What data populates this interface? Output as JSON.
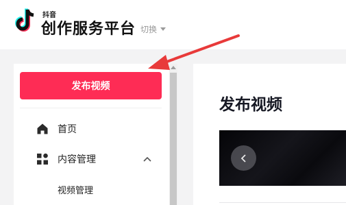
{
  "header": {
    "brand_small": "抖音",
    "brand_main": "创作服务平台",
    "switch_label": "切换"
  },
  "sidebar": {
    "publish_button": "发布视频",
    "items": [
      {
        "label": "首页",
        "icon": "home-icon"
      },
      {
        "label": "内容管理",
        "icon": "apps-icon",
        "expanded": true
      }
    ],
    "sub_items": [
      {
        "label": "视频管理"
      }
    ]
  },
  "main": {
    "title": "发布视频"
  },
  "colors": {
    "accent": "#fe2c55",
    "annotation_arrow": "#e83a3a",
    "background": "#f3f3f4"
  }
}
